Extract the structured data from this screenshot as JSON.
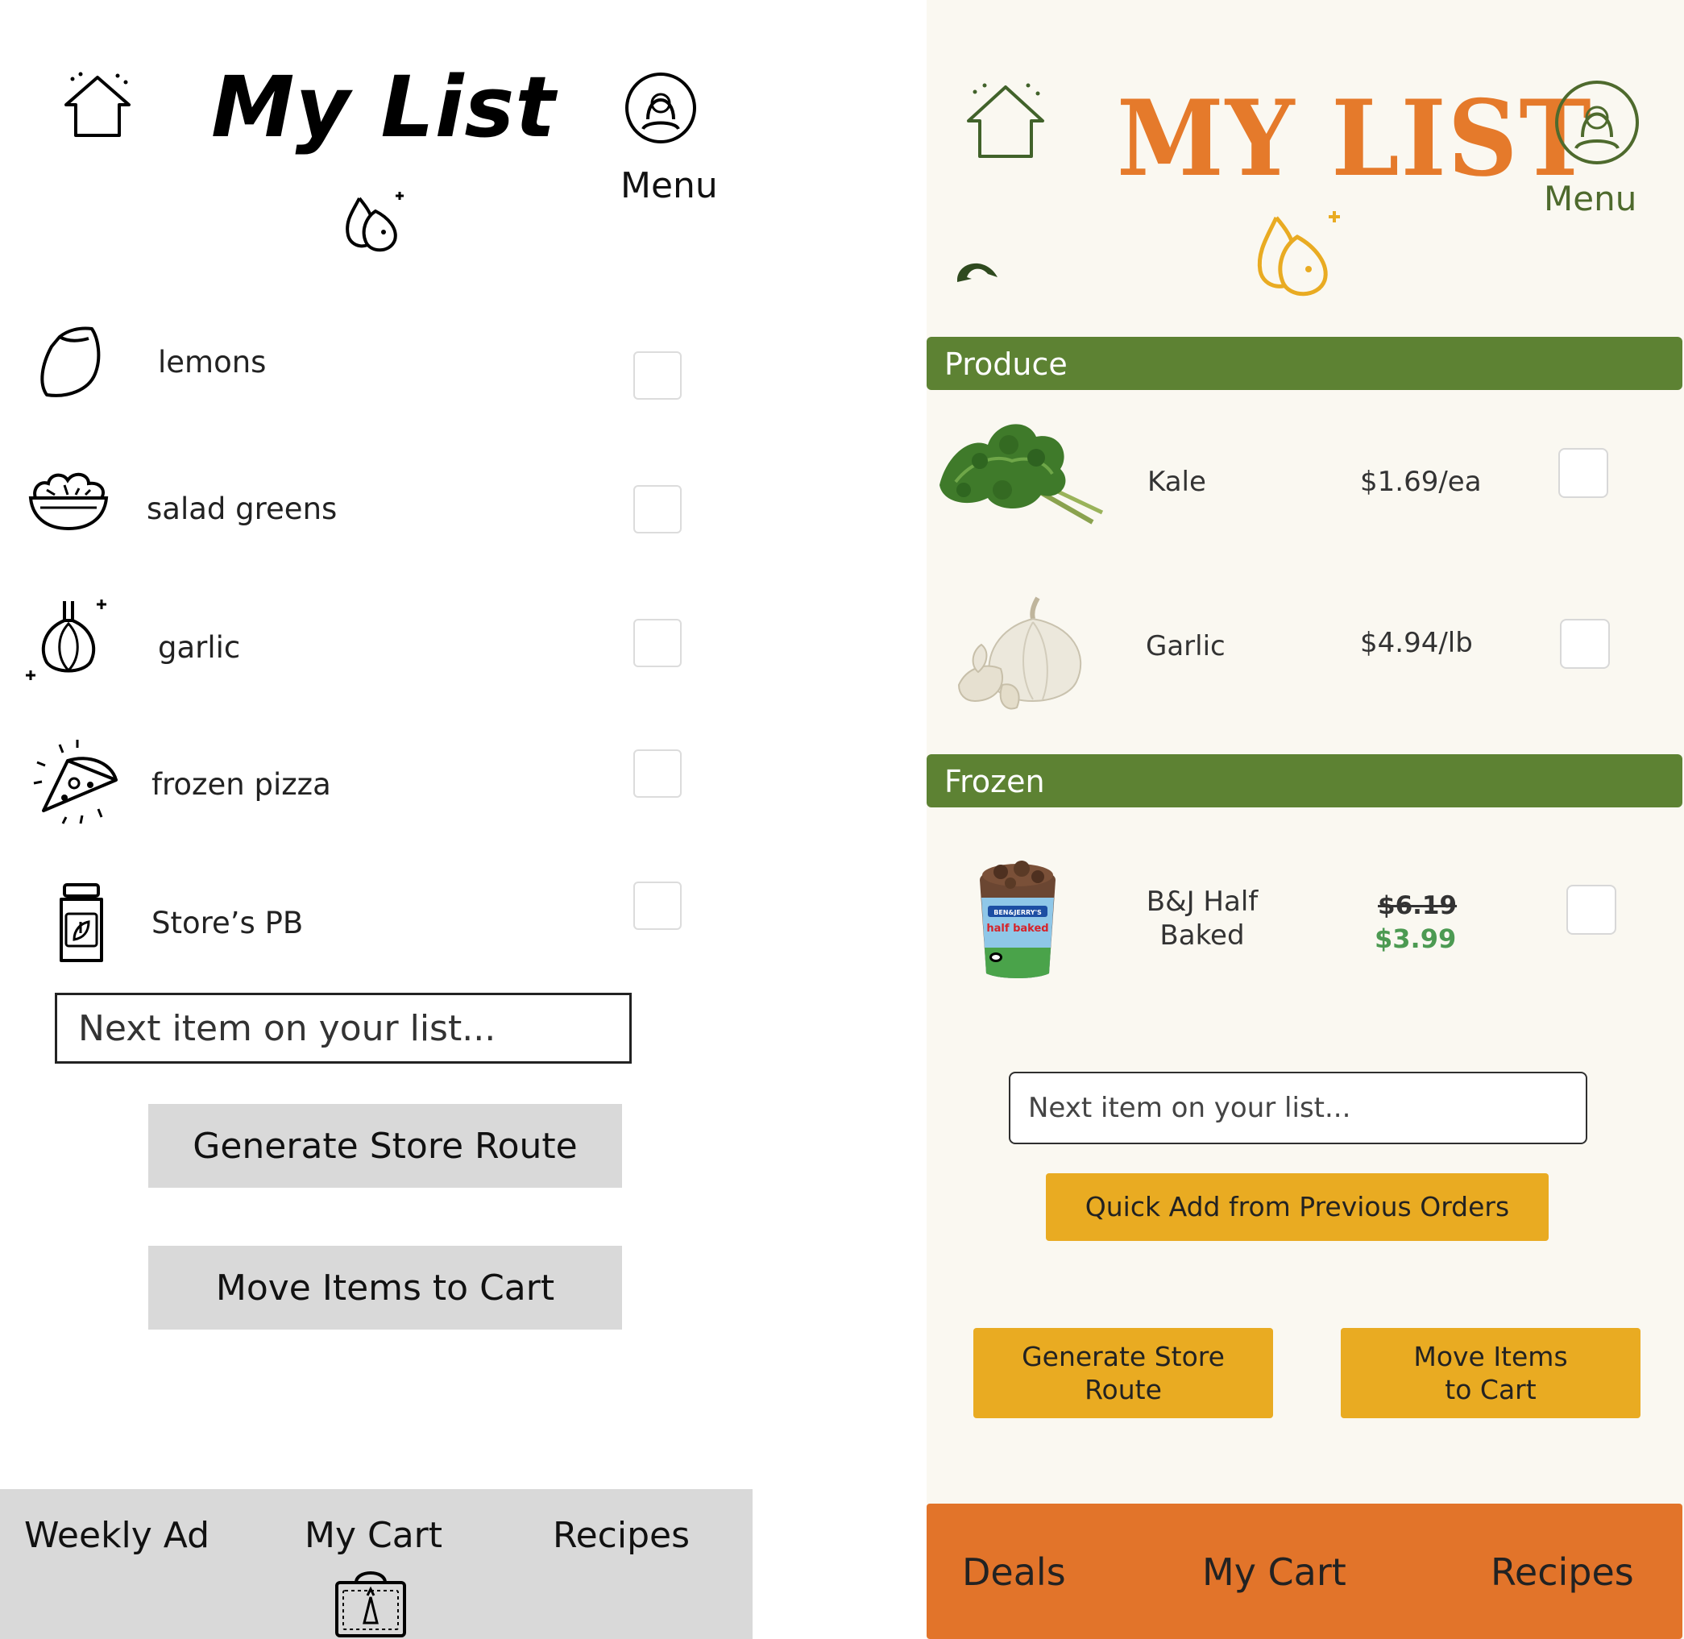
{
  "wireframe": {
    "title": "My List",
    "menu_label": "Menu",
    "items": [
      {
        "label": "lemons",
        "icon": "lemon-icon"
      },
      {
        "label": "salad greens",
        "icon": "salad-bowl-icon"
      },
      {
        "label": "garlic",
        "icon": "garlic-icon"
      },
      {
        "label": "frozen pizza",
        "icon": "pizza-slice-icon"
      },
      {
        "label": "Store’s PB",
        "icon": "jar-icon"
      }
    ],
    "input_placeholder": "Next item on your list...",
    "buttons": {
      "route": "Generate Store Route",
      "cart": "Move Items to Cart"
    },
    "nav": {
      "weekly_ad": "Weekly Ad",
      "my_cart": "My Cart",
      "recipes": "Recipes"
    }
  },
  "styled": {
    "title": "MY LIST",
    "menu_label": "Menu",
    "categories": {
      "produce": "Produce",
      "frozen": "Frozen"
    },
    "products": [
      {
        "name": "Kale",
        "price": "$1.69/ea",
        "image": "kale-image"
      },
      {
        "name": "Garlic",
        "price": "$4.94/lb",
        "image": "garlic-image"
      },
      {
        "name_line1": "B&J Half",
        "name_line2": "Baked",
        "old_price": "$6.19",
        "sale_price": "$3.99",
        "image": "ice-cream-pint-image",
        "brand_label": "BEN&JERRY'S",
        "flavor_label": "half baked"
      }
    ],
    "input_placeholder": "Next item on your list...",
    "buttons": {
      "quick_add": "Quick Add from Previous Orders",
      "route_line1": "Generate Store",
      "route_line2": "Route",
      "cart_line1": "Move Items",
      "cart_line2": "to Cart"
    },
    "nav": {
      "deals": "Deals",
      "my_cart": "My Cart",
      "recipes": "Recipes"
    }
  },
  "colors": {
    "orange": "#e57a2b",
    "green": "#5d8233",
    "gold": "#e9ab22",
    "sale_green": "#4c9a52",
    "nav_orange": "#e2742a",
    "wire_gray": "#d9d9d9"
  }
}
